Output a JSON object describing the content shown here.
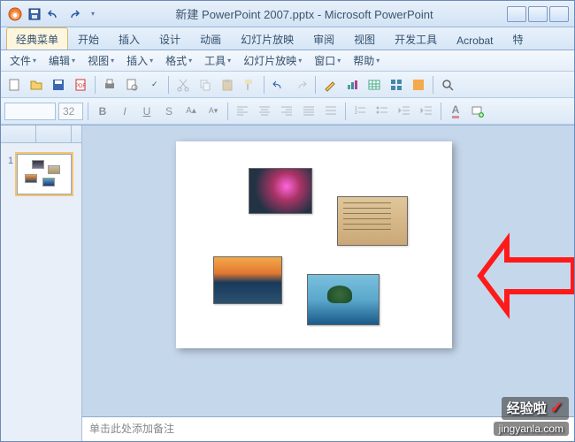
{
  "title": "新建 PowerPoint 2007.pptx - Microsoft PowerPoint",
  "ribbonTabs": [
    {
      "label": "经典菜单",
      "active": true
    },
    {
      "label": "开始"
    },
    {
      "label": "插入"
    },
    {
      "label": "设计"
    },
    {
      "label": "动画"
    },
    {
      "label": "幻灯片放映"
    },
    {
      "label": "审阅"
    },
    {
      "label": "视图"
    },
    {
      "label": "开发工具"
    },
    {
      "label": "Acrobat"
    },
    {
      "label": "特"
    }
  ],
  "classicMenu": [
    {
      "label": "文件"
    },
    {
      "label": "编辑"
    },
    {
      "label": "视图"
    },
    {
      "label": "插入"
    },
    {
      "label": "格式"
    },
    {
      "label": "工具"
    },
    {
      "label": "幻灯片放映"
    },
    {
      "label": "窗口"
    },
    {
      "label": "帮助"
    }
  ],
  "fontName": "",
  "fontSize": "32",
  "slideNumber": "1",
  "notesPlaceholder": "单击此处添加备注",
  "watermark": {
    "brand": "经验啦",
    "check": "✓",
    "url": "jingyanla.com"
  },
  "colors": {
    "accent": "#f6c46a",
    "arrow": "#ff1a1a"
  },
  "icons": {
    "save": "save-icon",
    "undo": "undo-icon",
    "redo": "redo-icon",
    "new": "new-icon",
    "open": "open-icon",
    "print": "print-icon",
    "bold": "B",
    "italic": "I",
    "underline": "U",
    "shadow": "S"
  }
}
